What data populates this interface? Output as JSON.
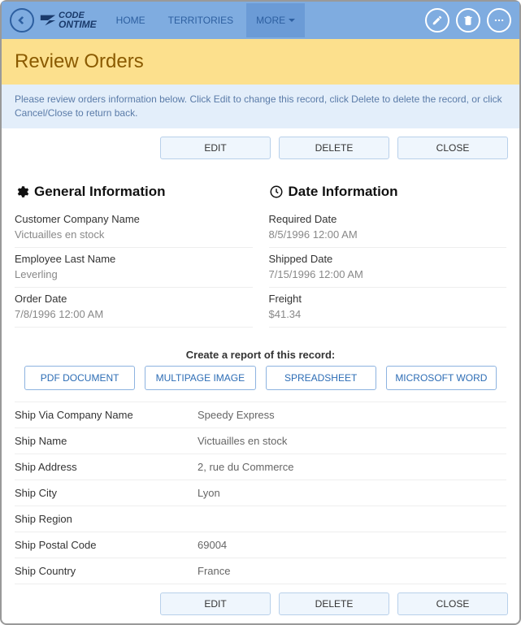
{
  "nav": {
    "home": "HOME",
    "territories": "TERRITORIES",
    "more": "MORE"
  },
  "logo": {
    "line1": "CODE",
    "line2": "ONTIME"
  },
  "title": "Review Orders",
  "info_text": "Please review orders information below. Click Edit to change this record, click Delete to delete the record, or click Cancel/Close to return back.",
  "actions": {
    "edit": "EDIT",
    "delete": "DELETE",
    "close": "CLOSE"
  },
  "sections": {
    "general": {
      "title": "General Information",
      "customer_label": "Customer Company Name",
      "customer_value": "Victuailles en stock",
      "employee_label": "Employee Last Name",
      "employee_value": "Leverling",
      "orderdate_label": "Order Date",
      "orderdate_value": "7/8/1996 12:00 AM"
    },
    "dates": {
      "title": "Date Information",
      "required_label": "Required Date",
      "required_value": "8/5/1996 12:00 AM",
      "shipped_label": "Shipped Date",
      "shipped_value": "7/15/1996 12:00 AM",
      "freight_label": "Freight",
      "freight_value": "$41.34"
    }
  },
  "report": {
    "title": "Create a report of this record:",
    "pdf": "PDF DOCUMENT",
    "multipage": "MULTIPAGE IMAGE",
    "spreadsheet": "SPREADSHEET",
    "word": "MICROSOFT WORD"
  },
  "ship": {
    "via_label": "Ship Via Company Name",
    "via_value": "Speedy Express",
    "name_label": "Ship Name",
    "name_value": "Victuailles en stock",
    "addr_label": "Ship Address",
    "addr_value": "2, rue du Commerce",
    "city_label": "Ship City",
    "city_value": "Lyon",
    "region_label": "Ship Region",
    "region_value": "",
    "postal_label": "Ship Postal Code",
    "postal_value": "69004",
    "country_label": "Ship Country",
    "country_value": "France"
  }
}
